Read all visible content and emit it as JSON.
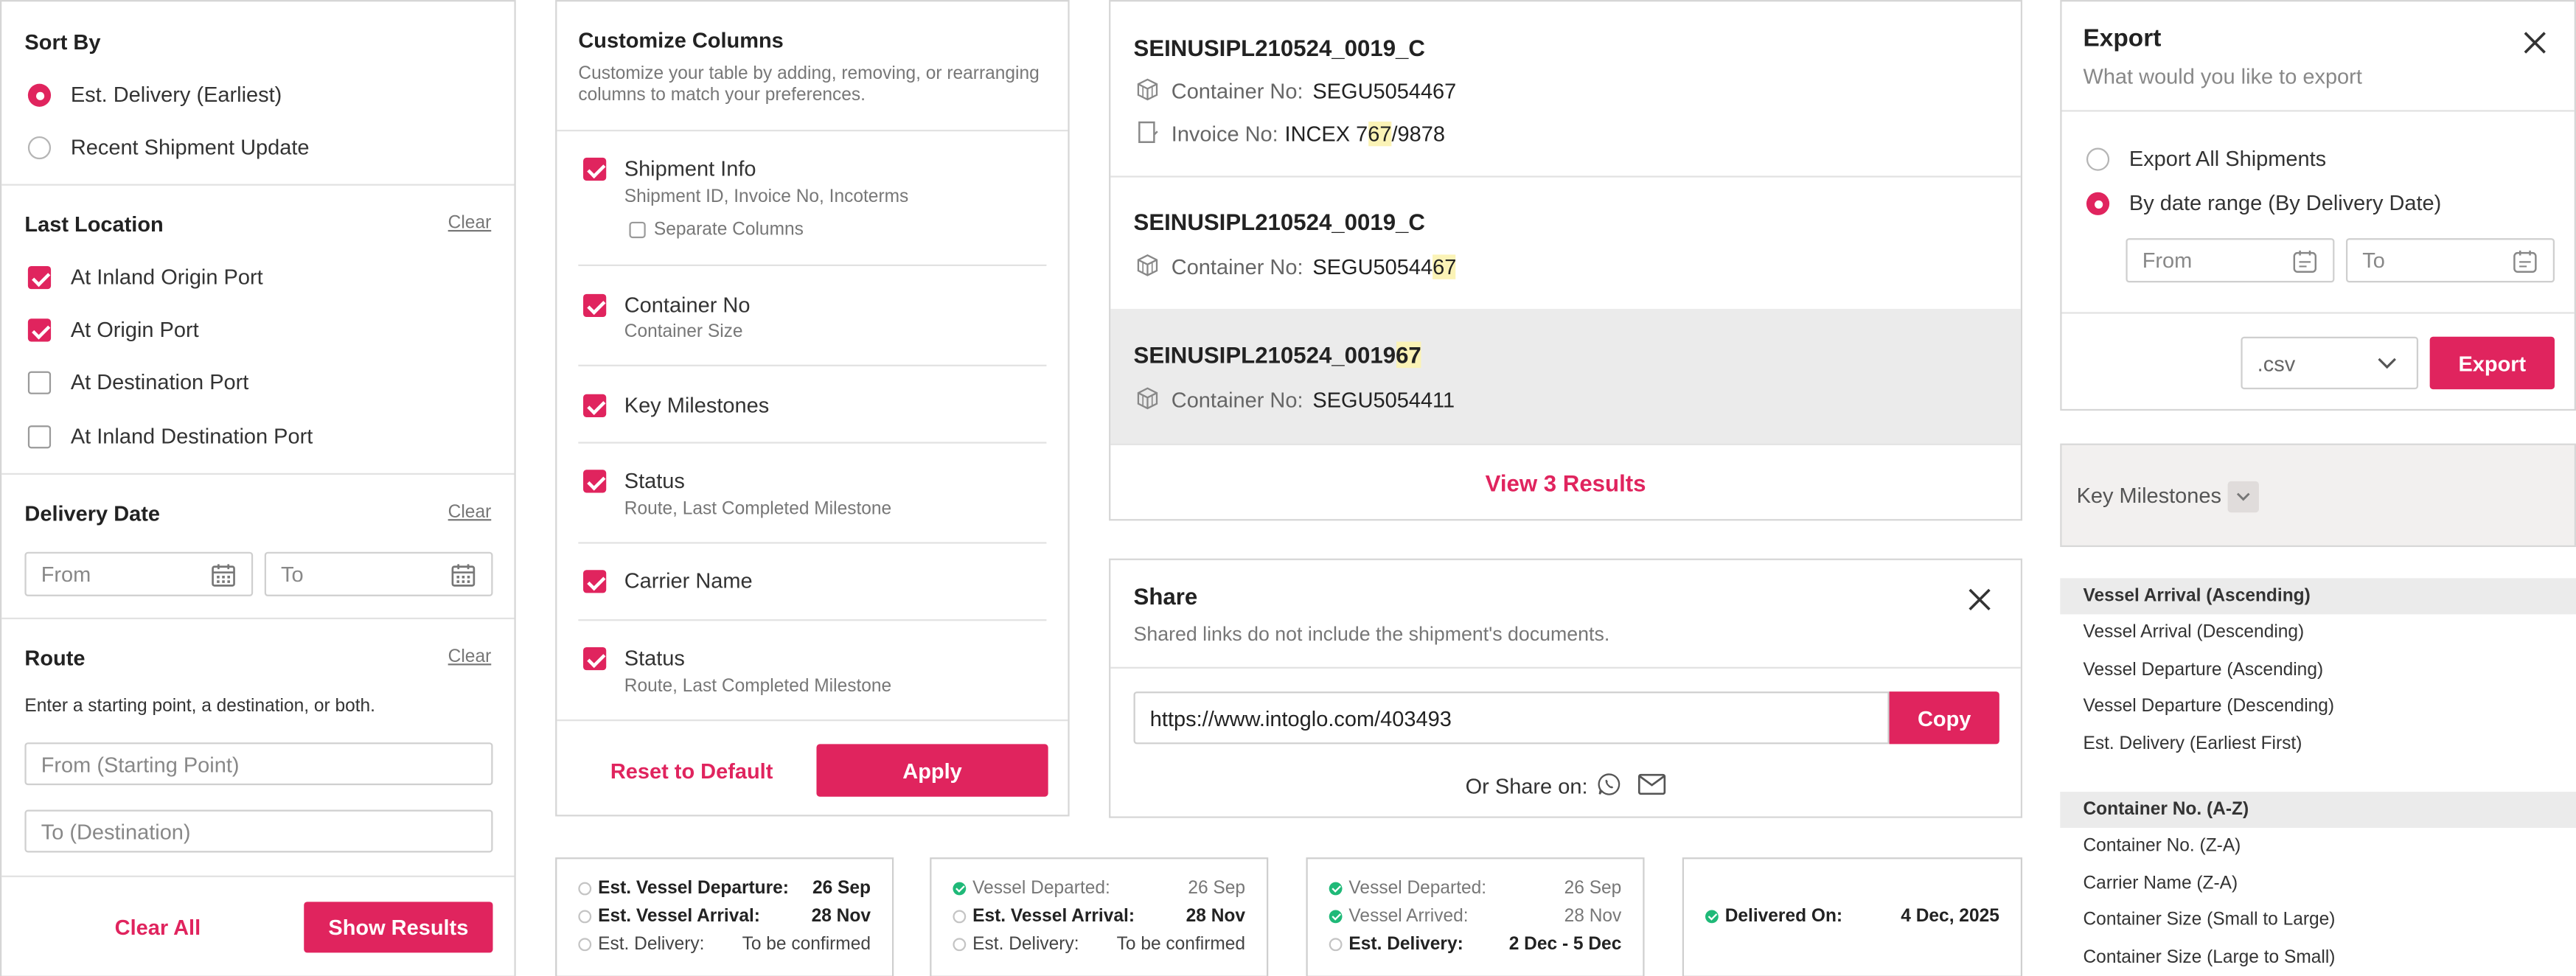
{
  "filters": {
    "sort_title": "Sort By",
    "sort_options": [
      "Est. Delivery (Earliest)",
      "Recent Shipment Update"
    ],
    "last_location_title": "Last Location",
    "clear_label": "Clear",
    "locations": [
      "At Inland Origin Port",
      "At Origin Port",
      "At Destination Port",
      "At Inland Destination Port"
    ],
    "delivery_date_title": "Delivery Date",
    "from_placeholder": "From",
    "to_placeholder": "To",
    "route_title": "Route",
    "route_hint": "Enter a starting point, a destination, or both.",
    "route_from_placeholder": "From (Starting Point)",
    "route_to_placeholder": "To (Destination)",
    "clear_all": "Clear All",
    "show_results": "Show Results"
  },
  "columns": {
    "title": "Customize Columns",
    "desc_line1": "Customize your table by adding, removing, or rearranging",
    "desc_line2": "columns to match your preferences.",
    "items": [
      {
        "label": "Shipment Info",
        "sub": "Shipment ID, Invoice No, Incoterms"
      },
      {
        "label": "Container No",
        "sub": "Container Size"
      },
      {
        "label": "Key Milestones",
        "sub": ""
      },
      {
        "label": "Status",
        "sub": "Route, Last Completed Milestone"
      },
      {
        "label": "Carrier Name",
        "sub": ""
      },
      {
        "label": "Status",
        "sub": "Route, Last Completed Milestone"
      }
    ],
    "separate_columns": "Separate Columns",
    "reset": "Reset to Default",
    "apply": "Apply"
  },
  "search": {
    "results": [
      {
        "id": "SEINUSIPL210524_0019_C",
        "container_label": "Container No:",
        "container": "SEGU5054467",
        "invoice_label": "Invoice No:",
        "invoice_pre": "INCEX 7",
        "invoice_hl": "67",
        "invoice_post": "/9878"
      },
      {
        "id": "SEINUSIPL210524_0019_C",
        "container_label": "Container No:",
        "container_pre": "SEGU50544",
        "container_hl": "67"
      },
      {
        "id_pre": "SEINUSIPL210524_0019",
        "id_hl": "67",
        "container_label": "Container No:",
        "container": "SEGU5054411"
      }
    ],
    "view_results": "View 3 Results"
  },
  "share": {
    "title": "Share",
    "subtitle": "Shared links do not include the shipment's documents.",
    "url": "https://www.intoglo.com/403493",
    "copy": "Copy",
    "or_share": "Or Share on:"
  },
  "milestones": [
    {
      "rows": [
        {
          "label": "Est. Vessel Departure:",
          "value": "26 Sep",
          "state": "pending",
          "bold": true
        },
        {
          "label": "Est. Vessel Arrival:",
          "value": "28 Nov",
          "state": "pending",
          "bold": true
        },
        {
          "label": "Est. Delivery:",
          "value": "To be confirmed",
          "state": "pending",
          "bold": false
        }
      ]
    },
    {
      "rows": [
        {
          "label": "Vessel Departed:",
          "value": "26 Sep",
          "state": "done",
          "bold": false
        },
        {
          "label": "Est. Vessel Arrival:",
          "value": "28 Nov",
          "state": "pending",
          "bold": true
        },
        {
          "label": "Est. Delivery:",
          "value": "To be confirmed",
          "state": "pending",
          "bold": false
        }
      ]
    },
    {
      "rows": [
        {
          "label": "Vessel Departed:",
          "value": "26 Sep",
          "state": "done",
          "bold": false
        },
        {
          "label": "Vessel Arrived:",
          "value": "28 Nov",
          "state": "done",
          "bold": false
        },
        {
          "label": "Est. Delivery:",
          "value": "2 Dec - 5 Dec",
          "state": "pending",
          "bold": true
        }
      ]
    },
    {
      "rows": [
        {
          "label": "Delivered On:",
          "value": "4 Dec, 2025",
          "state": "done",
          "bold": true
        }
      ]
    }
  ],
  "export": {
    "title": "Export",
    "subtitle": "What would you like to export",
    "options": [
      "Export All Shipments",
      "By date range (By Delivery Date)"
    ],
    "from": "From",
    "to": "To",
    "format": ".csv",
    "button": "Export"
  },
  "key_milestones": {
    "label": "Key Milestones"
  },
  "sort_menu": {
    "group1": [
      "Vessel Arrival (Ascending)",
      "Vessel Arrival (Descending)",
      "Vessel Departure (Ascending)",
      "Vessel Departure (Descending)",
      "Est. Delivery (Earliest First)"
    ],
    "group2": [
      "Container No. (A-Z)",
      "Container No. (Z-A)",
      "Carrier Name (Z-A)",
      "Container Size (Small to Large)",
      "Container Size (Large to Small)"
    ]
  },
  "colors": {
    "accent": "#e0245e",
    "success": "#1fb978",
    "highlight": "#fbf3b6"
  }
}
